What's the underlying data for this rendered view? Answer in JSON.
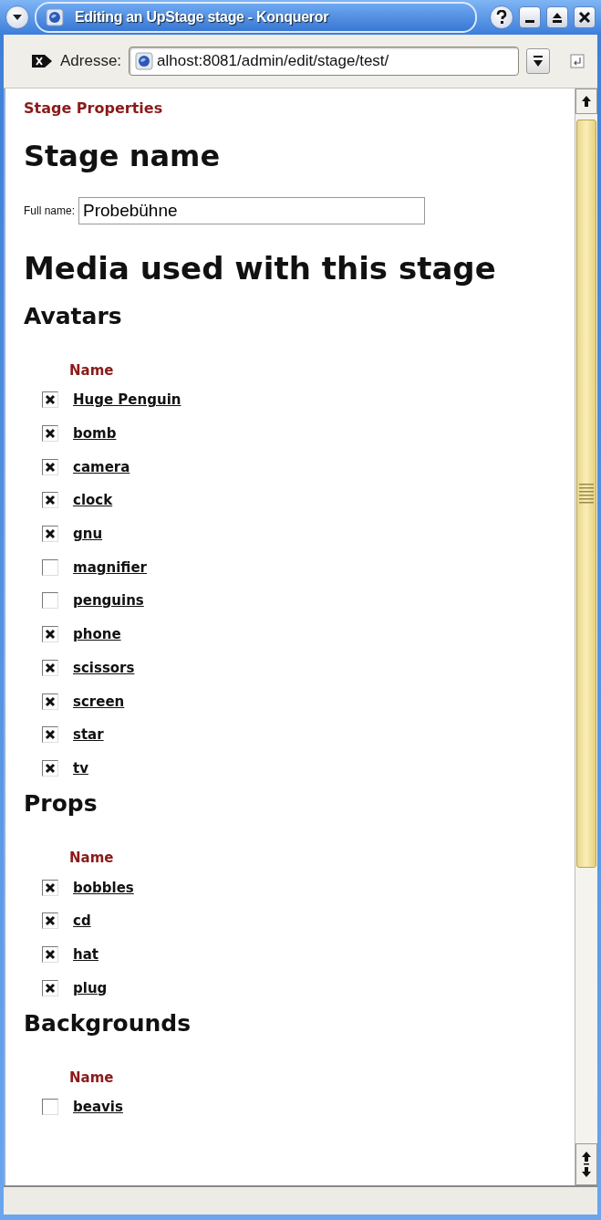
{
  "window": {
    "title": "Editing an UpStage stage - Konqueror"
  },
  "toolbar": {
    "address_label": "Adresse:",
    "url": "alhost:8081/admin/edit/stage/test/"
  },
  "page": {
    "breadcrumb": "Stage Properties",
    "name_heading": "Stage name",
    "full_name": {
      "label": "Full name:",
      "value": "Probebühne"
    },
    "media_heading": "Media used with this stage",
    "groups": [
      {
        "title": "Avatars",
        "column": "Name",
        "items": [
          {
            "name": "Huge Penguin",
            "checked": true
          },
          {
            "name": "bomb",
            "checked": true
          },
          {
            "name": "camera",
            "checked": true
          },
          {
            "name": "clock",
            "checked": true
          },
          {
            "name": "gnu",
            "checked": true
          },
          {
            "name": "magnifier",
            "checked": false
          },
          {
            "name": "penguins",
            "checked": false
          },
          {
            "name": "phone",
            "checked": true
          },
          {
            "name": "scissors",
            "checked": true
          },
          {
            "name": "screen",
            "checked": true
          },
          {
            "name": "star",
            "checked": true
          },
          {
            "name": "tv",
            "checked": true
          }
        ]
      },
      {
        "title": "Props",
        "column": "Name",
        "items": [
          {
            "name": "bobbles",
            "checked": true
          },
          {
            "name": "cd",
            "checked": true
          },
          {
            "name": "hat",
            "checked": true
          },
          {
            "name": "plug",
            "checked": true
          }
        ]
      },
      {
        "title": "Backgrounds",
        "column": "Name",
        "items": [
          {
            "name": "beavis",
            "checked": false
          }
        ]
      }
    ]
  }
}
